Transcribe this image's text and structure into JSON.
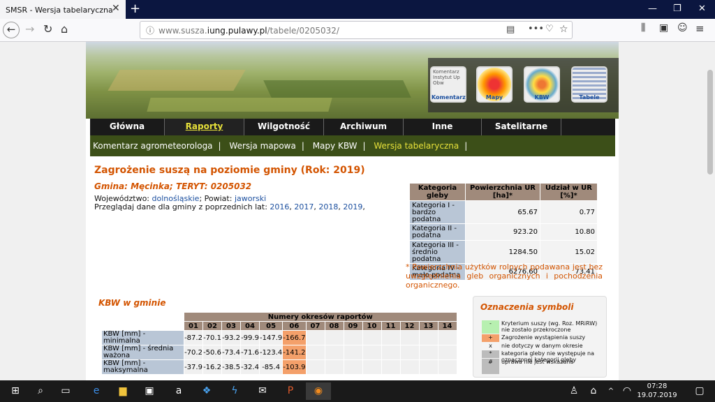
{
  "browser": {
    "tab_title": "SMSR - Wersja tabelaryczna",
    "url_prefix": "www.susza.",
    "url_domain": "iung.pulawy.pl",
    "url_path": "/tabele/0205032/"
  },
  "icons": [
    {
      "id": "komentarz",
      "label": "Komentarz",
      "thumb_text": "Komentarz Instytut Up Obw"
    },
    {
      "id": "mapy",
      "label": "Mapy"
    },
    {
      "id": "kbw",
      "label": "KBW"
    },
    {
      "id": "tabele",
      "label": "Tabele"
    }
  ],
  "menu": [
    "Główna",
    "Raporty",
    "Wilgotność gleby",
    "Archiwum",
    "Inne",
    "Satelitarne"
  ],
  "submenu": [
    "Komentarz agrometeorologa",
    "Wersja mapowa",
    "Mapy KBW",
    "Wersja tabelaryczna"
  ],
  "heading": "Zagrożenie suszą na poziomie gminy (Rok: 2019)",
  "subheading": "Gmina: Męcinka; TERYT: 0205032",
  "location": {
    "woj_label": "Województwo: ",
    "woj": "dolnośląskie",
    "pow_label": "; Powiat: ",
    "pow": "jaworski"
  },
  "prev_years": {
    "label": "Przeglądaj dane dla gminy z poprzednich lat: ",
    "years": [
      "2016",
      "2017",
      "2018",
      "2019"
    ]
  },
  "soil_table": {
    "headers": [
      "Kategoria gleby",
      "Powierzchnia UR [ha]*",
      "Udział w UR [%]*"
    ],
    "rows": [
      {
        "cat": "Kategoria I - bardzo podatna",
        "area": "65.67",
        "share": "0.77"
      },
      {
        "cat": "Kategoria II - podatna",
        "area": "923.20",
        "share": "10.80"
      },
      {
        "cat": "Kategoria III - średnio podatna",
        "area": "1284.50",
        "share": "15.02"
      },
      {
        "cat": "Kategoria IV - mało podatna",
        "area": "6276.60",
        "share": "73.41"
      }
    ]
  },
  "note": "* Powierzchnia użytków rolnych podawana jest bez uwzględnienia gleb organicznych i pochodzenia organicznego.",
  "kbw": {
    "title": "KBW w gminie",
    "header": "Numery okresów raportów",
    "periods": [
      "01",
      "02",
      "03",
      "04",
      "05",
      "06",
      "07",
      "08",
      "09",
      "10",
      "11",
      "12",
      "13",
      "14"
    ],
    "rows": [
      {
        "label": "KBW [mm] - minimalna",
        "values": [
          "-87.2",
          "-70.1",
          "-93.2",
          "-99.9",
          "-147.9",
          "-166.7"
        ]
      },
      {
        "label": "KBW [mm] - średnia ważona",
        "values": [
          "-70.2",
          "-50.6",
          "-73.4",
          "-71.6",
          "-123.4",
          "-141.2"
        ]
      },
      {
        "label": "KBW [mm] - maksymalna",
        "values": [
          "-37.9",
          "-16.2",
          "-38.5",
          "-32.4",
          "-85.4",
          "-103.9"
        ]
      }
    ]
  },
  "legend": {
    "title": "Oznaczenia symboli",
    "items": [
      {
        "sym": "-",
        "text": "Kryterium suszy (wg. Roz. MRiRW) nie zostało przekroczone",
        "color": "#b7f0b0"
      },
      {
        "sym": "+",
        "text": "Zagrożenie wystąpienia suszy",
        "color": "#f4a06a"
      },
      {
        "sym": "x",
        "text": "nie dotyczy w danym okresie",
        "color": "#f4f4f4"
      },
      {
        "sym": "*",
        "text": "kategoria gleby nie występuje na oznaczonej kategorii gleby",
        "color": "#bcbcbc"
      },
      {
        "sym": "#",
        "text": "uprawa nie jest wskazana",
        "color": "#bcbcbc"
      }
    ]
  },
  "taskbar": {
    "time": "07:28",
    "date": "19.07.2019"
  }
}
